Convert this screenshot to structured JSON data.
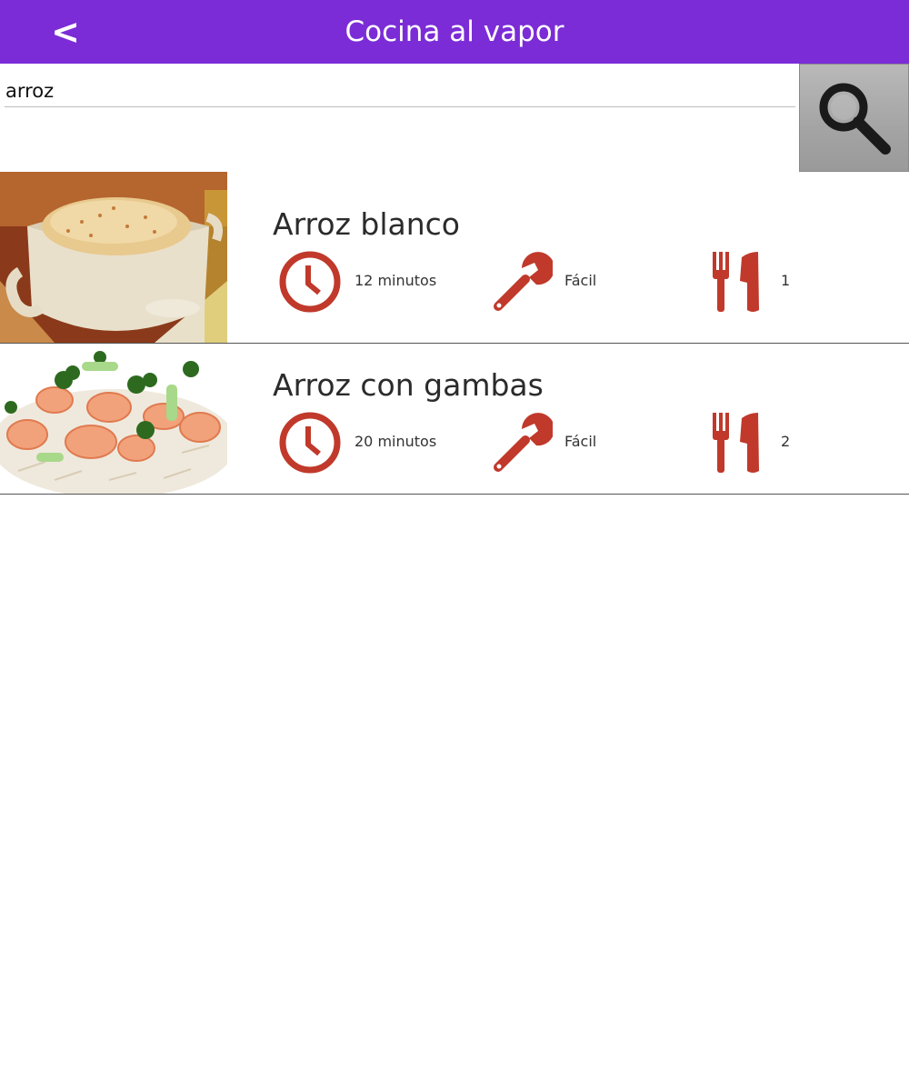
{
  "header": {
    "back_label": "<",
    "title": "Cocina al vapor",
    "color": "#7b2cd6"
  },
  "search": {
    "value": "arroz",
    "button_icon": "search-icon"
  },
  "accent_color": "#c0392b",
  "recipes": [
    {
      "title": "Arroz blanco",
      "time": "12 minutos",
      "difficulty": "Fácil",
      "servings": "1",
      "image": "rice-pot-photo"
    },
    {
      "title": "Arroz con gambas",
      "time": "20 minutos",
      "difficulty": "Fácil",
      "servings": "2",
      "image": "shrimp-rice-photo"
    }
  ]
}
